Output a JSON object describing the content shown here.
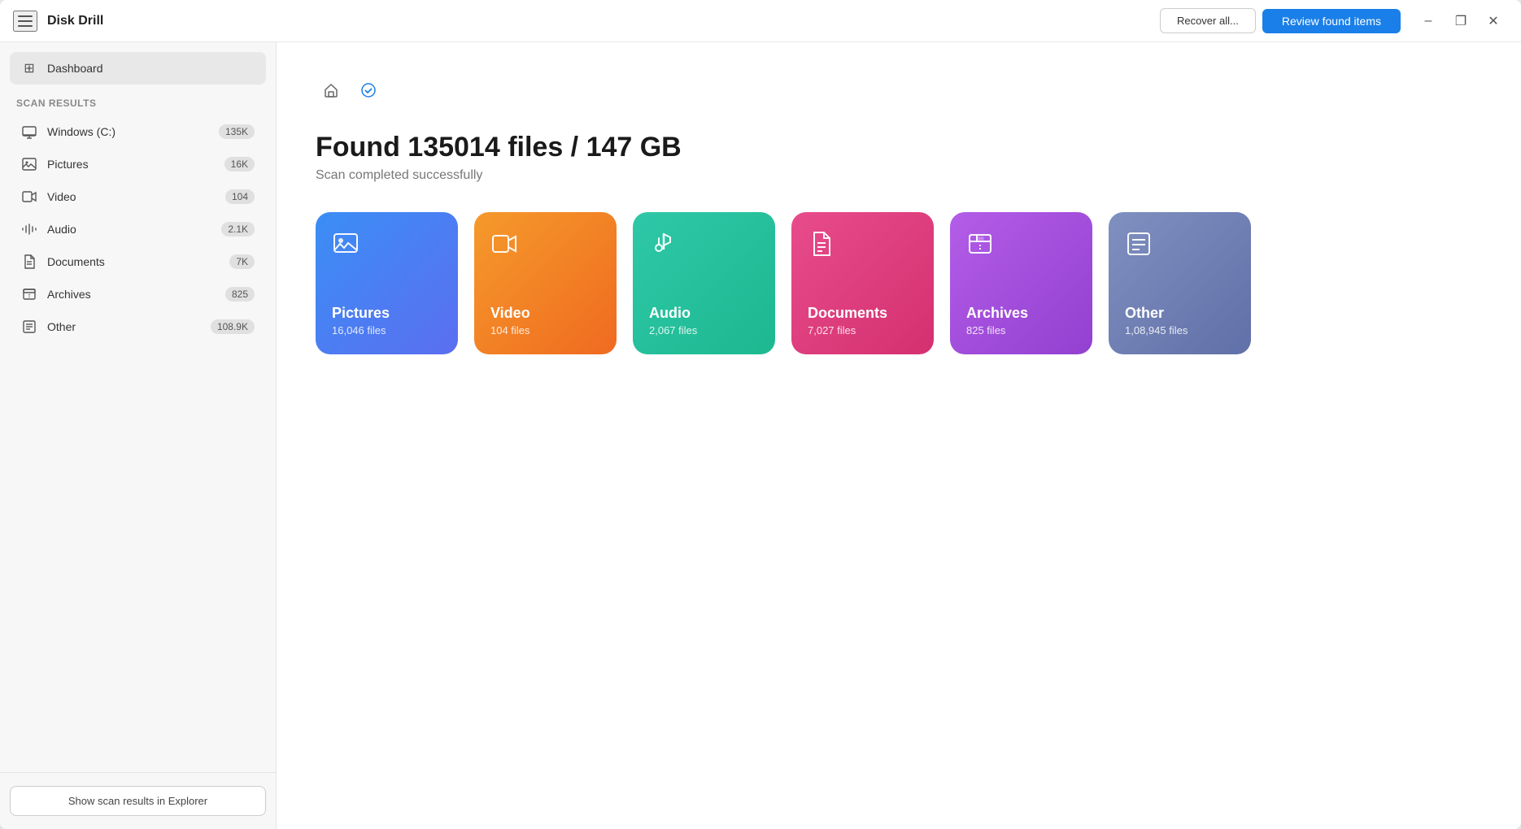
{
  "app": {
    "title": "Disk Drill"
  },
  "titlebar": {
    "recover_all_label": "Recover all...",
    "review_label": "Review found items",
    "minimize_label": "–",
    "maximize_label": "❐",
    "close_label": "✕"
  },
  "sidebar": {
    "nav_items": [
      {
        "id": "dashboard",
        "label": "Dashboard",
        "icon": "⊞",
        "active": true
      }
    ],
    "section_title": "Scan results",
    "list_items": [
      {
        "id": "windows",
        "label": "Windows (C:)",
        "icon": "💾",
        "count": "135K"
      },
      {
        "id": "pictures",
        "label": "Pictures",
        "icon": "🖼",
        "count": "16K"
      },
      {
        "id": "video",
        "label": "Video",
        "icon": "🎬",
        "count": "104"
      },
      {
        "id": "audio",
        "label": "Audio",
        "icon": "♪",
        "count": "2.1K"
      },
      {
        "id": "documents",
        "label": "Documents",
        "icon": "📄",
        "count": "7K"
      },
      {
        "id": "archives",
        "label": "Archives",
        "icon": "📦",
        "count": "825"
      },
      {
        "id": "other",
        "label": "Other",
        "icon": "📋",
        "count": "108.9K"
      }
    ],
    "footer_btn": "Show scan results in Explorer"
  },
  "toolbar": {
    "home_icon": "⌂",
    "check_icon": "✓"
  },
  "content": {
    "found_title": "Found 135014 files / 147 GB",
    "found_subtitle": "Scan completed successfully",
    "cards": [
      {
        "id": "pictures",
        "label": "Pictures",
        "count": "16,046 files",
        "css_class": "card-pictures",
        "icon": "🖼"
      },
      {
        "id": "video",
        "label": "Video",
        "count": "104 files",
        "css_class": "card-video",
        "icon": "🎞"
      },
      {
        "id": "audio",
        "label": "Audio",
        "count": "2,067 files",
        "css_class": "card-audio",
        "icon": "♪"
      },
      {
        "id": "documents",
        "label": "Documents",
        "count": "7,027 files",
        "css_class": "card-documents",
        "icon": "📄"
      },
      {
        "id": "archives",
        "label": "Archives",
        "count": "825 files",
        "css_class": "card-archives",
        "icon": "📦"
      },
      {
        "id": "other",
        "label": "Other",
        "count": "1,08,945 files",
        "css_class": "card-other",
        "icon": "📋"
      }
    ]
  }
}
